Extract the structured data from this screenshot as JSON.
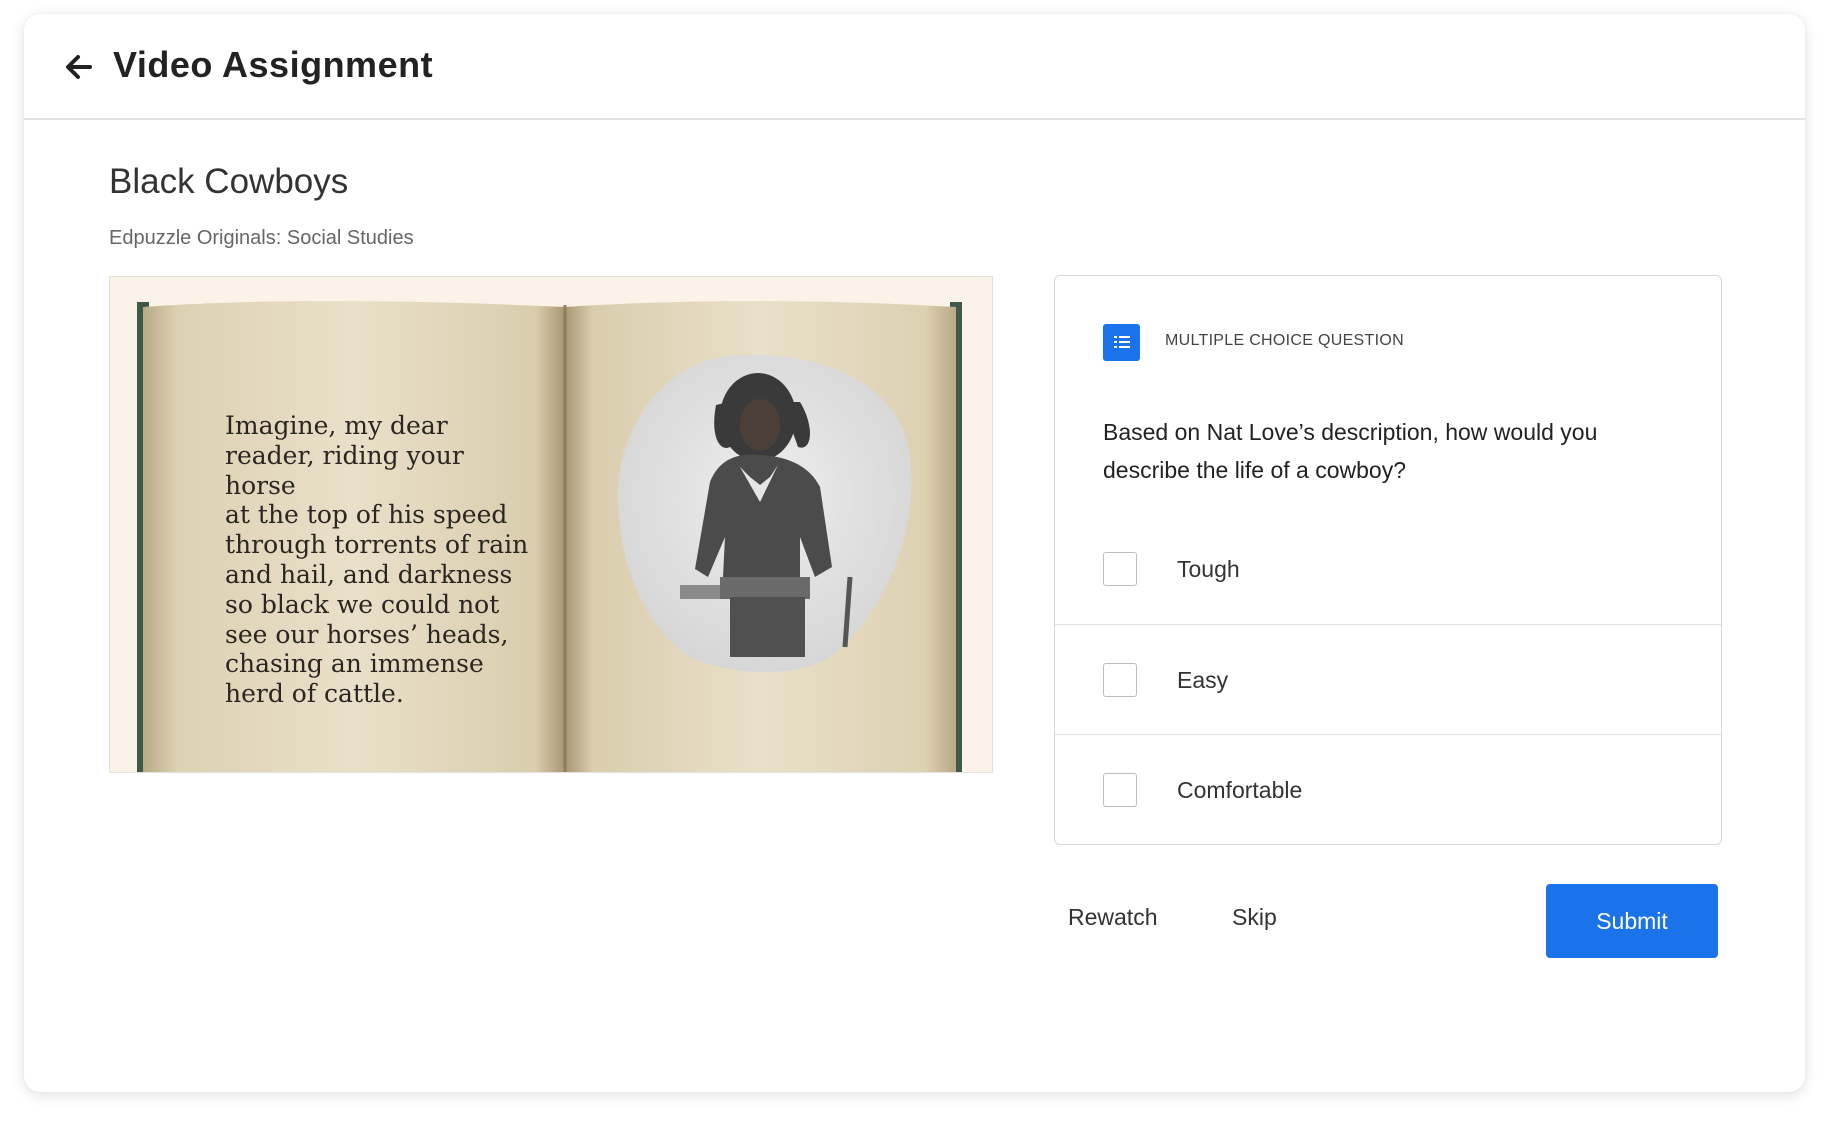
{
  "header": {
    "title": "Video Assignment"
  },
  "video": {
    "title": "Black Cowboys",
    "source": "Edpuzzle Originals: Social Studies",
    "book_text": "Imagine, my dear\nreader, riding your horse\nat the top of his speed\nthrough torrents of rain\nand hail, and darkness\nso black we could not\nsee our horses’ heads,\nchasing an immense\nherd of cattle."
  },
  "question": {
    "type_label": "MULTIPLE CHOICE QUESTION",
    "text": "Based on Nat Love’s description, how would you describe the life of a cowboy?",
    "options": [
      {
        "label": "Tough",
        "checked": false
      },
      {
        "label": "Easy",
        "checked": false
      },
      {
        "label": "Comfortable",
        "checked": false
      }
    ]
  },
  "actions": {
    "rewatch_label": "Rewatch",
    "skip_label": "Skip",
    "submit_label": "Submit"
  },
  "colors": {
    "accent": "#1a73e8",
    "border": "#d9d9d9"
  }
}
